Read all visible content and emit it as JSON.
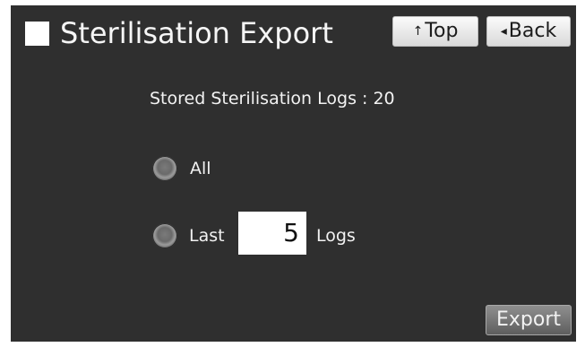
{
  "header": {
    "title": "Sterilisation Export",
    "top_label": "Top",
    "top_icon": "up-arrow-icon",
    "back_label": "Back",
    "back_icon": "left-triangle-icon"
  },
  "content": {
    "stored_logs_text": "Stored Sterilisation Logs : 20",
    "option_all_label": "All",
    "option_last_label": "Last",
    "last_count_value": "5",
    "logs_label": "Logs"
  },
  "footer": {
    "export_label": "Export"
  }
}
